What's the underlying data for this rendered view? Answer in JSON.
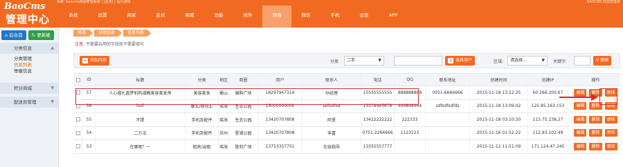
{
  "header": {
    "logo": "BaoCms",
    "subtitle": "管理中心",
    "sysinfo": "系统: baocms商城管理系统 | [更改] | 站内通知",
    "userinfo": "BAOCMS 欢迎您登录"
  },
  "nav": {
    "items": [
      "系统",
      "设置",
      "商家",
      "会员",
      "商城",
      "功能",
      "插件",
      "频道",
      "微信",
      "手机",
      "运营",
      "APP"
    ],
    "active_index": 7
  },
  "sidebar": {
    "home_label": "后台首",
    "refresh_label": "更新缓",
    "groups": [
      {
        "title": "分类信息",
        "links": [
          "分类管理",
          "信息列表",
          "举报信息"
        ],
        "active_link": 1
      },
      {
        "title": "积分商城",
        "links": []
      },
      {
        "title": "配送员管理",
        "links": []
      }
    ]
  },
  "breadcrumb": [
    "频道",
    "分类信息",
    "信息列表"
  ],
  "notice": {
    "prefix": "注意:",
    "text": "不需要启用的字段就不需要填写"
  },
  "toolbar": {
    "add_label": "添加内容",
    "category_label": "分类",
    "category_value": "二手",
    "select_user_label": "选择用户",
    "region_label": "区域:",
    "region_value": "请选择...",
    "keyword_label": "关键字:",
    "search_label": "搜索"
  },
  "table": {
    "headers": [
      "",
      "ID",
      "标题",
      "分类",
      "地区",
      "商圈",
      "用户",
      "联系人",
      "电话",
      "QQ",
      "联系地址",
      "创建时间",
      "创建IP",
      "操作"
    ],
    "rows": [
      [
        "",
        "57",
        "人心擅扎盖梦机构减糊美容美发师",
        "美容美发",
        "蜀山",
        "国购广场",
        "18297947314",
        "孙经理",
        "15555555555",
        "888888888",
        "0551-6666666",
        "2015-11-18 13:22:25",
        "60.166.200.67"
      ],
      [
        "",
        "56",
        "fsdf",
        "摩车/助冈车",
        "瑶海",
        "生态公园",
        "15000000000",
        "sdfsdfsd",
        "13378945678",
        "444848944",
        "sdfsdfsdfds",
        "2015-11-18 13:09:02",
        "125.85.163.153"
      ],
      [
        "",
        "55",
        "不提",
        "手机及配件",
        "瑶海",
        "生态公园",
        "13420707808",
        "阿里",
        "13422222222",
        "222333",
        "",
        "2015-11-18 03:10:20",
        "113.75.238.27"
      ],
      [
        "",
        "54",
        "二方法",
        "手机及配件",
        "苏州",
        "星湖公园",
        "13420707808",
        "丰富",
        "0751-2266666",
        "1123123",
        "",
        "2015-11-16 01:52:22",
        "112.93.102.49"
      ],
      [
        "",
        "53",
        "在哪呢？一",
        "租房/出租",
        "瑶海",
        "胜利广场",
        "13753357751",
        "在线指导",
        "13355557777",
        "",
        "",
        "2015-11-12 11:51:09",
        "171.124.47.245"
      ]
    ],
    "actions": [
      "编辑",
      "删除",
      "审核"
    ]
  },
  "colors": {
    "brand": "#f26a22",
    "highlight": "#d6282c"
  }
}
